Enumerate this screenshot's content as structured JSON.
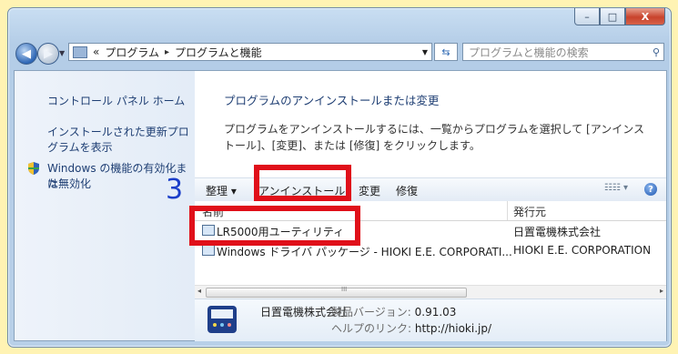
{
  "window": {
    "caption_buttons": [
      "–",
      "□",
      "X"
    ]
  },
  "address": {
    "prefix": "«",
    "crumbs": [
      "プログラム",
      "プログラムと機能"
    ],
    "separator": "▸",
    "search_placeholder": "プログラムと機能の検索"
  },
  "sidebar": {
    "items": [
      {
        "label": "コントロール パネル ホーム"
      },
      {
        "label": "インストールされた更新プロ"
      },
      {
        "label": "グラムを表示"
      },
      {
        "label": "Windows の機能の有効化また"
      },
      {
        "label": "は無効化"
      }
    ],
    "step_number": "3"
  },
  "main": {
    "title": "プログラムのアンインストールまたは変更",
    "desc_line1": "プログラムをアンインストールするには、一覧からプログラムを選択して [アンインス",
    "desc_line2": "トール]、[変更]、または [修復] をクリックします。"
  },
  "toolbar": {
    "organize": "整理 ▾",
    "uninstall": "アンインストール",
    "change": "変更",
    "repair": "修復",
    "view": "☷☷ ▾",
    "help": "?"
  },
  "list": {
    "col_name": "名前",
    "col_publisher": "発行元",
    "rows": [
      {
        "name": "LR5000用ユーティリティ",
        "publisher": "日置電機株式会社"
      },
      {
        "name": "Windows ドライバ パッケージ - HIOKI E.E. CORPORATI...",
        "publisher": "HIOKI E.E. CORPORATION"
      }
    ]
  },
  "scrollbar": {
    "left": "◂",
    "right": "▸",
    "grip": "III"
  },
  "details": {
    "publisher": "日置電機株式会社",
    "version_label": "製品バージョン:",
    "version_value": "0.91.03",
    "help_label": "ヘルプのリンク:",
    "help_value": "http://hioki.jp/"
  },
  "colors": {
    "highlight": "#e0101a",
    "link": "#1e3e73",
    "step": "#1a3ec9"
  }
}
